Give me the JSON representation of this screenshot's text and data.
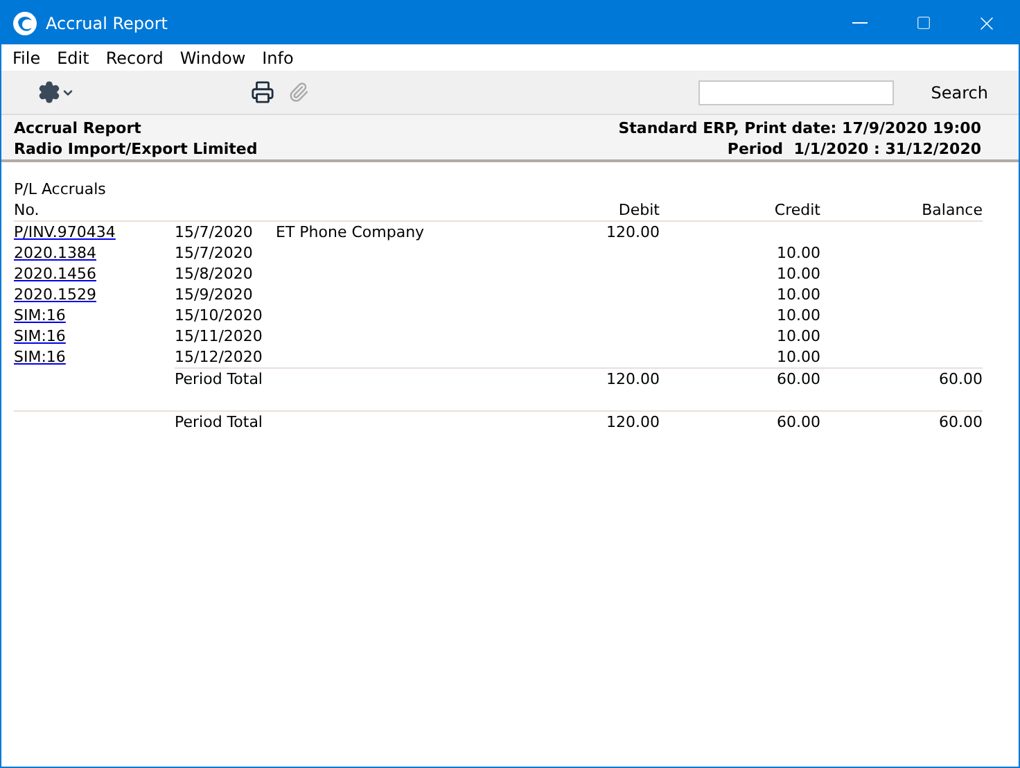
{
  "window": {
    "title": "Accrual Report"
  },
  "menu": [
    "File",
    "Edit",
    "Record",
    "Window",
    "Info"
  ],
  "toolbar": {
    "search_button": "Search"
  },
  "header": {
    "left": [
      "Accrual Report",
      "Radio Import/Export Limited"
    ],
    "right": [
      "Standard ERP, Print date: 17/9/2020 19:00",
      "Period  1/1/2020 : 31/12/2020"
    ]
  },
  "report": {
    "section": "P/L Accruals",
    "columns": [
      "No.",
      "Debit",
      "Credit",
      "Balance"
    ],
    "rows": [
      {
        "no": "P/INV.970434",
        "date": "15/7/2020",
        "description": "ET Phone Company",
        "debit": "120.00"
      },
      {
        "no": "2020.1384",
        "date": "15/7/2020",
        "credit": "10.00"
      },
      {
        "no": "2020.1456",
        "date": "15/8/2020",
        "credit": "10.00"
      },
      {
        "no": "2020.1529",
        "date": "15/9/2020",
        "credit": "10.00"
      },
      {
        "no": "SIM:16",
        "date": "15/10/2020",
        "credit": "10.00"
      },
      {
        "no": "SIM:16",
        "date": "15/11/2020",
        "credit": "10.00"
      },
      {
        "no": "SIM:16",
        "date": "15/12/2020",
        "credit": "10.00"
      }
    ],
    "totals": [
      {
        "kind": "section",
        "label": "Period Total",
        "debit": "120.00",
        "credit": "60.00",
        "balance": "60.00"
      },
      {
        "kind": "grand",
        "label": "Period Total",
        "debit": "120.00",
        "credit": "60.00",
        "balance": "60.00"
      }
    ]
  }
}
